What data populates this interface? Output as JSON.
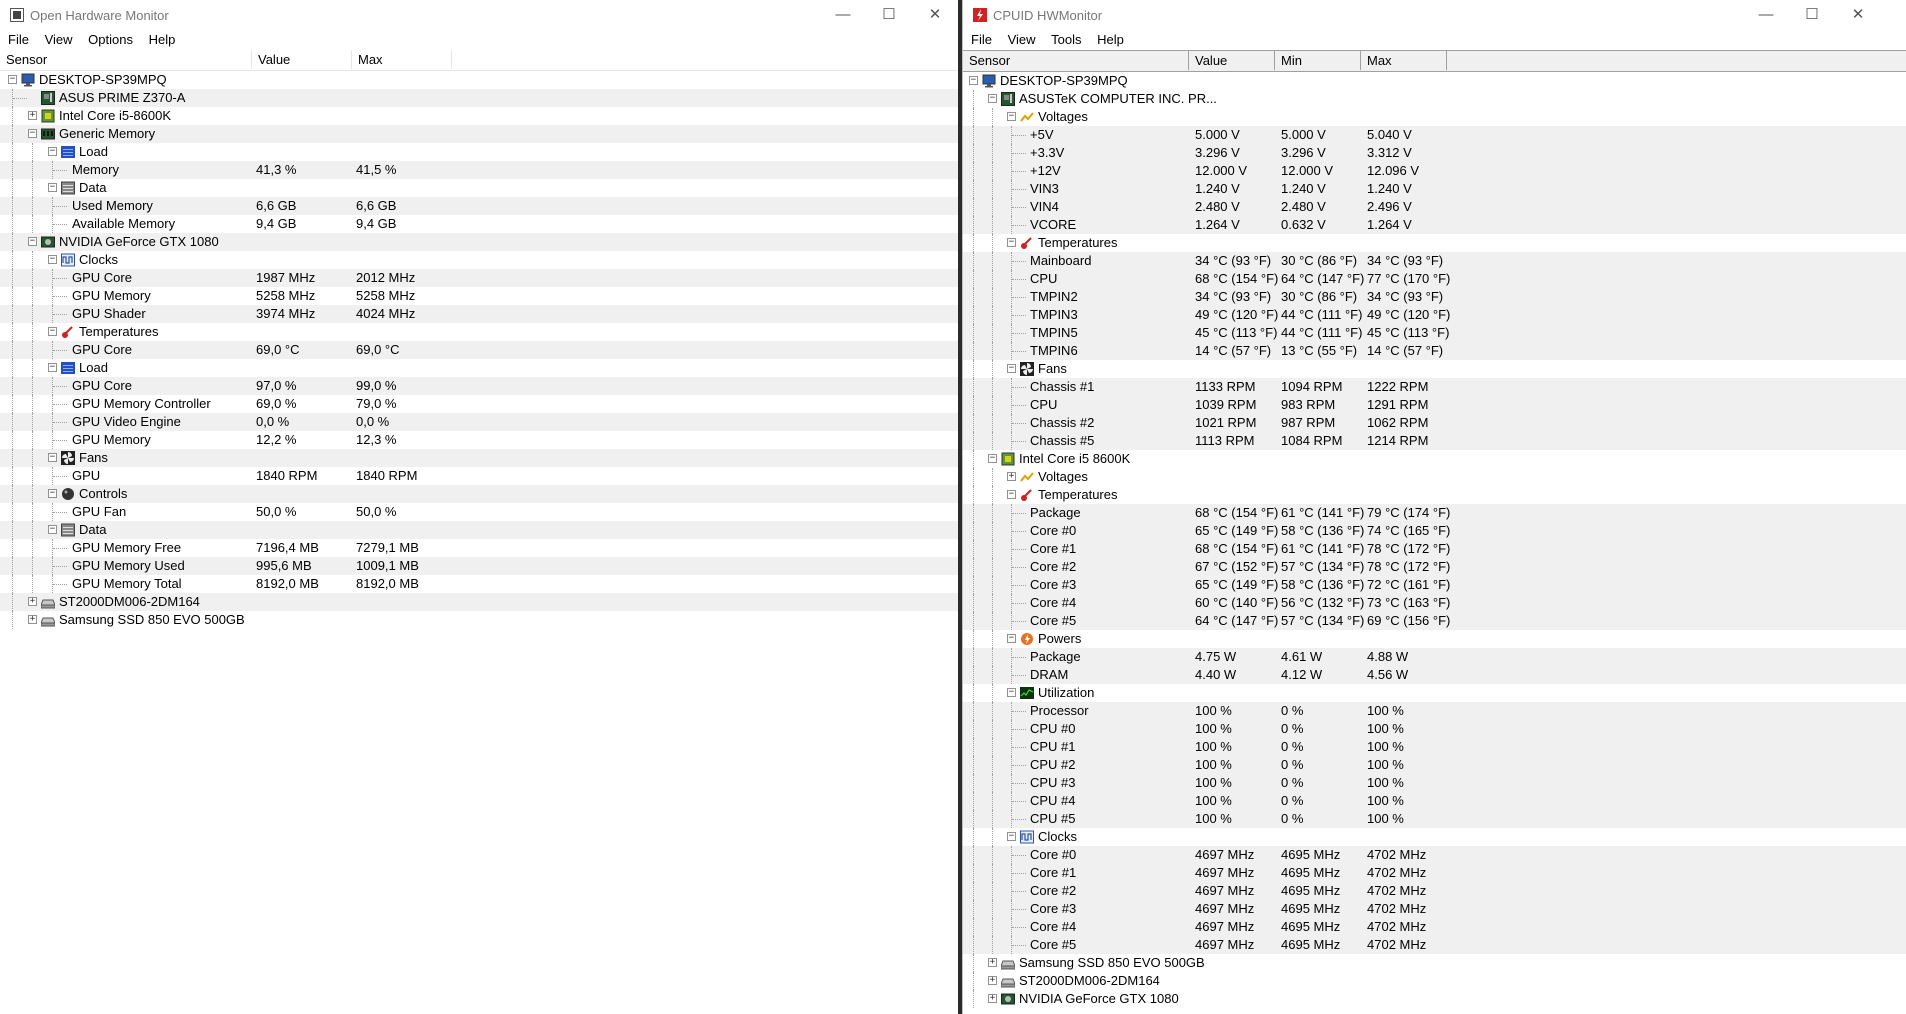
{
  "ohm": {
    "title": "Open Hardware Monitor",
    "menu": [
      "File",
      "View",
      "Options",
      "Help"
    ],
    "headers": [
      "Sensor",
      "Value",
      "Max"
    ],
    "rows": [
      {
        "level": 0,
        "exp": "-",
        "icon": "computer-icon",
        "label": "DESKTOP-SP39MPQ",
        "value": "",
        "max": ""
      },
      {
        "level": 1,
        "exp": "",
        "icon": "motherboard-icon",
        "label": "ASUS PRIME Z370-A",
        "value": "",
        "max": ""
      },
      {
        "level": 1,
        "exp": "+",
        "icon": "cpu-icon",
        "label": "Intel Core i5-8600K",
        "value": "",
        "max": ""
      },
      {
        "level": 1,
        "exp": "-",
        "icon": "memory-icon",
        "label": "Generic Memory",
        "value": "",
        "max": ""
      },
      {
        "level": 2,
        "exp": "-",
        "icon": "load-icon",
        "label": "Load",
        "value": "",
        "max": ""
      },
      {
        "level": 3,
        "exp": "",
        "icon": "",
        "label": "Memory",
        "value": "41,3 %",
        "max": "41,5 %"
      },
      {
        "level": 2,
        "exp": "-",
        "icon": "data-icon",
        "label": "Data",
        "value": "",
        "max": ""
      },
      {
        "level": 3,
        "exp": "",
        "icon": "",
        "label": "Used Memory",
        "value": "6,6 GB",
        "max": "6,6 GB"
      },
      {
        "level": 3,
        "exp": "",
        "icon": "",
        "label": "Available Memory",
        "value": "9,4 GB",
        "max": "9,4 GB"
      },
      {
        "level": 1,
        "exp": "-",
        "icon": "gpu-icon",
        "label": "NVIDIA GeForce GTX 1080",
        "value": "",
        "max": ""
      },
      {
        "level": 2,
        "exp": "-",
        "icon": "clock-icon",
        "label": "Clocks",
        "value": "",
        "max": ""
      },
      {
        "level": 3,
        "exp": "",
        "icon": "",
        "label": "GPU Core",
        "value": "1987 MHz",
        "max": "2012 MHz"
      },
      {
        "level": 3,
        "exp": "",
        "icon": "",
        "label": "GPU Memory",
        "value": "5258 MHz",
        "max": "5258 MHz"
      },
      {
        "level": 3,
        "exp": "",
        "icon": "",
        "label": "GPU Shader",
        "value": "3974 MHz",
        "max": "4024 MHz"
      },
      {
        "level": 2,
        "exp": "-",
        "icon": "thermometer-icon",
        "label": "Temperatures",
        "value": "",
        "max": ""
      },
      {
        "level": 3,
        "exp": "",
        "icon": "",
        "label": "GPU Core",
        "value": "69,0 °C",
        "max": "69,0 °C"
      },
      {
        "level": 2,
        "exp": "-",
        "icon": "load-icon",
        "label": "Load",
        "value": "",
        "max": ""
      },
      {
        "level": 3,
        "exp": "",
        "icon": "",
        "label": "GPU Core",
        "value": "97,0 %",
        "max": "99,0 %"
      },
      {
        "level": 3,
        "exp": "",
        "icon": "",
        "label": "GPU Memory Controller",
        "value": "69,0 %",
        "max": "79,0 %"
      },
      {
        "level": 3,
        "exp": "",
        "icon": "",
        "label": "GPU Video Engine",
        "value": "0,0 %",
        "max": "0,0 %"
      },
      {
        "level": 3,
        "exp": "",
        "icon": "",
        "label": "GPU Memory",
        "value": "12,2 %",
        "max": "12,3 %"
      },
      {
        "level": 2,
        "exp": "-",
        "icon": "fan-icon",
        "label": "Fans",
        "value": "",
        "max": ""
      },
      {
        "level": 3,
        "exp": "",
        "icon": "",
        "label": "GPU",
        "value": "1840 RPM",
        "max": "1840 RPM"
      },
      {
        "level": 2,
        "exp": "-",
        "icon": "control-icon",
        "label": "Controls",
        "value": "",
        "max": ""
      },
      {
        "level": 3,
        "exp": "",
        "icon": "",
        "label": "GPU Fan",
        "value": "50,0 %",
        "max": "50,0 %"
      },
      {
        "level": 2,
        "exp": "-",
        "icon": "data-icon",
        "label": "Data",
        "value": "",
        "max": ""
      },
      {
        "level": 3,
        "exp": "",
        "icon": "",
        "label": "GPU Memory Free",
        "value": "7196,4 MB",
        "max": "7279,1 MB"
      },
      {
        "level": 3,
        "exp": "",
        "icon": "",
        "label": "GPU Memory Used",
        "value": "995,6 MB",
        "max": "1009,1 MB"
      },
      {
        "level": 3,
        "exp": "",
        "icon": "",
        "label": "GPU Memory Total",
        "value": "8192,0 MB",
        "max": "8192,0 MB"
      },
      {
        "level": 1,
        "exp": "+",
        "icon": "hdd-icon",
        "label": "ST2000DM006-2DM164",
        "value": "",
        "max": ""
      },
      {
        "level": 1,
        "exp": "+",
        "icon": "hdd-icon",
        "label": "Samsung SSD 850 EVO 500GB",
        "value": "",
        "max": ""
      }
    ]
  },
  "hwm": {
    "title": "CPUID HWMonitor",
    "menu": [
      "File",
      "View",
      "Tools",
      "Help"
    ],
    "headers": [
      "Sensor",
      "Value",
      "Min",
      "Max"
    ],
    "rows": [
      {
        "level": 0,
        "exp": "-",
        "icon": "computer-icon",
        "label": "DESKTOP-SP39MPQ",
        "value": "",
        "min": "",
        "max": ""
      },
      {
        "level": 1,
        "exp": "-",
        "icon": "motherboard-icon",
        "label": "ASUSTeK COMPUTER INC. PR...",
        "value": "",
        "min": "",
        "max": ""
      },
      {
        "level": 2,
        "exp": "-",
        "icon": "voltage-icon",
        "label": "Voltages",
        "value": "",
        "min": "",
        "max": ""
      },
      {
        "level": 3,
        "exp": "",
        "icon": "",
        "label": "+5V",
        "value": "5.000 V",
        "min": "5.000 V",
        "max": "5.040 V"
      },
      {
        "level": 3,
        "exp": "",
        "icon": "",
        "label": "+3.3V",
        "value": "3.296 V",
        "min": "3.296 V",
        "max": "3.312 V"
      },
      {
        "level": 3,
        "exp": "",
        "icon": "",
        "label": "+12V",
        "value": "12.000 V",
        "min": "12.000 V",
        "max": "12.096 V"
      },
      {
        "level": 3,
        "exp": "",
        "icon": "",
        "label": "VIN3",
        "value": "1.240 V",
        "min": "1.240 V",
        "max": "1.240 V"
      },
      {
        "level": 3,
        "exp": "",
        "icon": "",
        "label": "VIN4",
        "value": "2.480 V",
        "min": "2.480 V",
        "max": "2.496 V"
      },
      {
        "level": 3,
        "exp": "",
        "icon": "",
        "label": "VCORE",
        "value": "1.264 V",
        "min": "0.632 V",
        "max": "1.264 V"
      },
      {
        "level": 2,
        "exp": "-",
        "icon": "thermometer-icon",
        "label": "Temperatures",
        "value": "",
        "min": "",
        "max": ""
      },
      {
        "level": 3,
        "exp": "",
        "icon": "",
        "label": "Mainboard",
        "value": "34 °C  (93 °F)",
        "min": "30 °C  (86 °F)",
        "max": "34 °C  (93 °F)"
      },
      {
        "level": 3,
        "exp": "",
        "icon": "",
        "label": "CPU",
        "value": "68 °C  (154 °F)",
        "min": "64 °C  (147 °F)",
        "max": "77 °C  (170 °F)"
      },
      {
        "level": 3,
        "exp": "",
        "icon": "",
        "label": "TMPIN2",
        "value": "34 °C  (93 °F)",
        "min": "30 °C  (86 °F)",
        "max": "34 °C  (93 °F)"
      },
      {
        "level": 3,
        "exp": "",
        "icon": "",
        "label": "TMPIN3",
        "value": "49 °C  (120 °F)",
        "min": "44 °C  (111 °F)",
        "max": "49 °C  (120 °F)"
      },
      {
        "level": 3,
        "exp": "",
        "icon": "",
        "label": "TMPIN5",
        "value": "45 °C  (113 °F)",
        "min": "44 °C  (111 °F)",
        "max": "45 °C  (113 °F)"
      },
      {
        "level": 3,
        "exp": "",
        "icon": "",
        "label": "TMPIN6",
        "value": "14 °C  (57 °F)",
        "min": "13 °C  (55 °F)",
        "max": "14 °C  (57 °F)"
      },
      {
        "level": 2,
        "exp": "-",
        "icon": "fan-icon",
        "label": "Fans",
        "value": "",
        "min": "",
        "max": ""
      },
      {
        "level": 3,
        "exp": "",
        "icon": "",
        "label": "Chassis #1",
        "value": "1133 RPM",
        "min": "1094 RPM",
        "max": "1222 RPM"
      },
      {
        "level": 3,
        "exp": "",
        "icon": "",
        "label": "CPU",
        "value": "1039 RPM",
        "min": "983 RPM",
        "max": "1291 RPM"
      },
      {
        "level": 3,
        "exp": "",
        "icon": "",
        "label": "Chassis #2",
        "value": "1021 RPM",
        "min": "987 RPM",
        "max": "1062 RPM"
      },
      {
        "level": 3,
        "exp": "",
        "icon": "",
        "label": "Chassis #5",
        "value": "1113 RPM",
        "min": "1084 RPM",
        "max": "1214 RPM"
      },
      {
        "level": 1,
        "exp": "-",
        "icon": "cpu-icon",
        "label": "Intel Core i5 8600K",
        "value": "",
        "min": "",
        "max": ""
      },
      {
        "level": 2,
        "exp": "+",
        "icon": "voltage-icon",
        "label": "Voltages",
        "value": "",
        "min": "",
        "max": ""
      },
      {
        "level": 2,
        "exp": "-",
        "icon": "thermometer-icon",
        "label": "Temperatures",
        "value": "",
        "min": "",
        "max": ""
      },
      {
        "level": 3,
        "exp": "",
        "icon": "",
        "label": "Package",
        "value": "68 °C  (154 °F)",
        "min": "61 °C  (141 °F)",
        "max": "79 °C  (174 °F)"
      },
      {
        "level": 3,
        "exp": "",
        "icon": "",
        "label": "Core #0",
        "value": "65 °C  (149 °F)",
        "min": "58 °C  (136 °F)",
        "max": "74 °C  (165 °F)"
      },
      {
        "level": 3,
        "exp": "",
        "icon": "",
        "label": "Core #1",
        "value": "68 °C  (154 °F)",
        "min": "61 °C  (141 °F)",
        "max": "78 °C  (172 °F)"
      },
      {
        "level": 3,
        "exp": "",
        "icon": "",
        "label": "Core #2",
        "value": "67 °C  (152 °F)",
        "min": "57 °C  (134 °F)",
        "max": "78 °C  (172 °F)"
      },
      {
        "level": 3,
        "exp": "",
        "icon": "",
        "label": "Core #3",
        "value": "65 °C  (149 °F)",
        "min": "58 °C  (136 °F)",
        "max": "72 °C  (161 °F)"
      },
      {
        "level": 3,
        "exp": "",
        "icon": "",
        "label": "Core #4",
        "value": "60 °C  (140 °F)",
        "min": "56 °C  (132 °F)",
        "max": "73 °C  (163 °F)"
      },
      {
        "level": 3,
        "exp": "",
        "icon": "",
        "label": "Core #5",
        "value": "64 °C  (147 °F)",
        "min": "57 °C  (134 °F)",
        "max": "69 °C  (156 °F)"
      },
      {
        "level": 2,
        "exp": "-",
        "icon": "power-icon",
        "label": "Powers",
        "value": "",
        "min": "",
        "max": ""
      },
      {
        "level": 3,
        "exp": "",
        "icon": "",
        "label": "Package",
        "value": "4.75 W",
        "min": "4.61 W",
        "max": "4.88 W"
      },
      {
        "level": 3,
        "exp": "",
        "icon": "",
        "label": "DRAM",
        "value": "4.40 W",
        "min": "4.12 W",
        "max": "4.56 W"
      },
      {
        "level": 2,
        "exp": "-",
        "icon": "utilization-icon",
        "label": "Utilization",
        "value": "",
        "min": "",
        "max": ""
      },
      {
        "level": 3,
        "exp": "",
        "icon": "",
        "label": "Processor",
        "value": "100 %",
        "min": "0 %",
        "max": "100 %"
      },
      {
        "level": 3,
        "exp": "",
        "icon": "",
        "label": "CPU #0",
        "value": "100 %",
        "min": "0 %",
        "max": "100 %"
      },
      {
        "level": 3,
        "exp": "",
        "icon": "",
        "label": "CPU #1",
        "value": "100 %",
        "min": "0 %",
        "max": "100 %"
      },
      {
        "level": 3,
        "exp": "",
        "icon": "",
        "label": "CPU #2",
        "value": "100 %",
        "min": "0 %",
        "max": "100 %"
      },
      {
        "level": 3,
        "exp": "",
        "icon": "",
        "label": "CPU #3",
        "value": "100 %",
        "min": "0 %",
        "max": "100 %"
      },
      {
        "level": 3,
        "exp": "",
        "icon": "",
        "label": "CPU #4",
        "value": "100 %",
        "min": "0 %",
        "max": "100 %"
      },
      {
        "level": 3,
        "exp": "",
        "icon": "",
        "label": "CPU #5",
        "value": "100 %",
        "min": "0 %",
        "max": "100 %"
      },
      {
        "level": 2,
        "exp": "-",
        "icon": "clock-icon",
        "label": "Clocks",
        "value": "",
        "min": "",
        "max": ""
      },
      {
        "level": 3,
        "exp": "",
        "icon": "",
        "label": "Core #0",
        "value": "4697 MHz",
        "min": "4695 MHz",
        "max": "4702 MHz"
      },
      {
        "level": 3,
        "exp": "",
        "icon": "",
        "label": "Core #1",
        "value": "4697 MHz",
        "min": "4695 MHz",
        "max": "4702 MHz"
      },
      {
        "level": 3,
        "exp": "",
        "icon": "",
        "label": "Core #2",
        "value": "4697 MHz",
        "min": "4695 MHz",
        "max": "4702 MHz"
      },
      {
        "level": 3,
        "exp": "",
        "icon": "",
        "label": "Core #3",
        "value": "4697 MHz",
        "min": "4695 MHz",
        "max": "4702 MHz"
      },
      {
        "level": 3,
        "exp": "",
        "icon": "",
        "label": "Core #4",
        "value": "4697 MHz",
        "min": "4695 MHz",
        "max": "4702 MHz"
      },
      {
        "level": 3,
        "exp": "",
        "icon": "",
        "label": "Core #5",
        "value": "4697 MHz",
        "min": "4695 MHz",
        "max": "4702 MHz"
      },
      {
        "level": 1,
        "exp": "+",
        "icon": "hdd-icon",
        "label": "Samsung SSD 850 EVO 500GB",
        "value": "",
        "min": "",
        "max": ""
      },
      {
        "level": 1,
        "exp": "+",
        "icon": "hdd-icon",
        "label": "ST2000DM006-2DM164",
        "value": "",
        "min": "",
        "max": ""
      },
      {
        "level": 1,
        "exp": "+",
        "icon": "gpu-icon",
        "label": "NVIDIA GeForce GTX 1080",
        "value": "",
        "min": "",
        "max": ""
      }
    ]
  },
  "window_controls": {
    "minimize": "—",
    "maximize": "☐",
    "close": "✕"
  },
  "colors": {
    "alt_row": "#f0f0f0",
    "header_bg": "#f0f0f0",
    "hwm_icon": "#d42020",
    "divider": "#2b2b2b"
  }
}
